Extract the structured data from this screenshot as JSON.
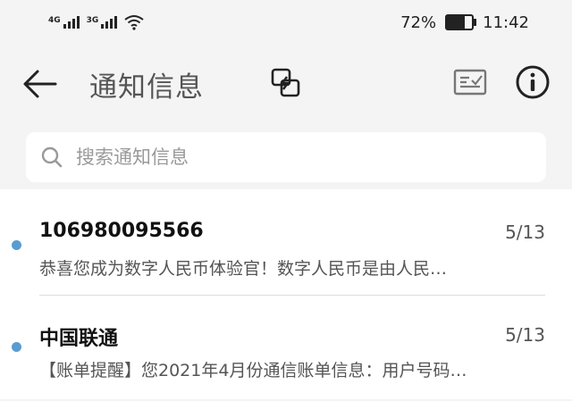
{
  "status": {
    "net1": "4G",
    "net2": "3G",
    "battery_percent": "72%",
    "battery_level": 72,
    "time": "11:42"
  },
  "header": {
    "title": "通知信息",
    "icons": [
      "back-arrow-icon",
      "switch-icon",
      "message-icon",
      "info-icon"
    ]
  },
  "search": {
    "placeholder": "搜索通知信息"
  },
  "messages": [
    {
      "sender": "106980095566",
      "date": "5/13",
      "preview": "恭喜您成为数字人民币体验官！数字人民币是由人民…",
      "unread": true
    },
    {
      "sender": "中国联通",
      "date": "5/13",
      "preview": "【账单提醒】您2021年4月份通信账单信息：用户号码…",
      "unread": true
    }
  ],
  "colors": {
    "unread_dot": "#5a9cd0",
    "background": "#f4f4f4"
  }
}
